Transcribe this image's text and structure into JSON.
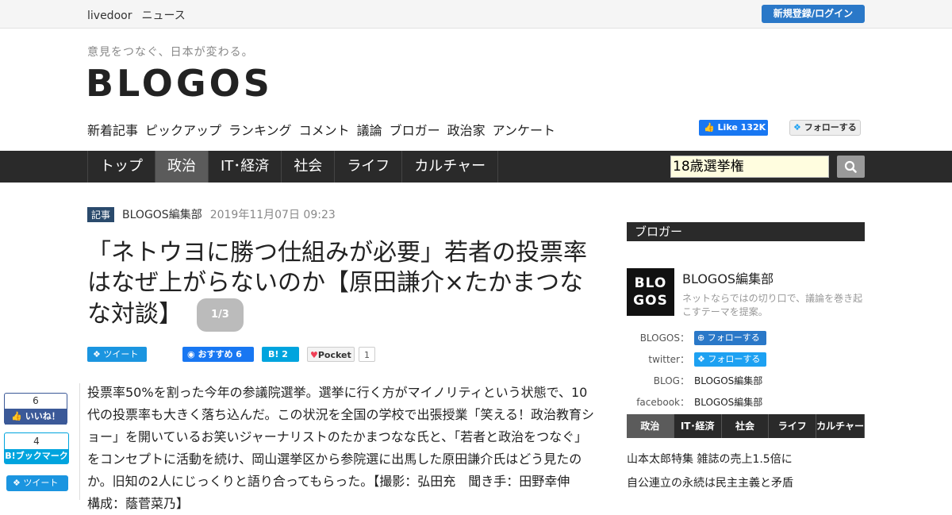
{
  "topbar": {
    "brand1": "livedoor",
    "brand2": "ニュース",
    "login": "新規登録/ログイン"
  },
  "header": {
    "tagline": "意見をつなぐ、日本が変わる。",
    "logo": "BLOGOS",
    "subnav": [
      "新着記事",
      "ピックアップ",
      "ランキング",
      "コメント",
      "議論",
      "ブロガー",
      "政治家",
      "アンケート"
    ],
    "fb_like": "Like 132K",
    "tw_follow": "フォローする"
  },
  "mainnav": {
    "items": [
      "トップ",
      "政治",
      "IT･経済",
      "社会",
      "ライフ",
      "カルチャー"
    ],
    "active": "政治",
    "search_value": "18歳選挙権"
  },
  "article": {
    "category": "記事",
    "author": "BLOGOS編集部",
    "date": "2019年11月07日 09:23",
    "title": "「ネトウヨに勝つ仕組みが必要」若者の投票率はなぜ上がらないのか【原田謙介×たかまつなな対談】",
    "page": "1/3",
    "share": {
      "tweet": "ツイート",
      "fb": "おすすめ 6",
      "hatena": "2",
      "pocket": "Pocket",
      "pocket_count": "1"
    },
    "body_lines": [
      "投票率50%を割った今年の参議院選挙。選挙に行く方がマイノリティという状態で、10",
      "代の投票率も大きく落ち込んだ。この状況を全国の学校で出張授業「笑える！政治教育シ",
      "ョー」を開いているお笑いジャーナリストのたかまつなな氏と、「若者と政治をつなぐ」",
      "をコンセプトに活動を続け、岡山選挙区から参院選に出馬した原田謙介氏はどう見たの",
      "か。旧知の2人にじっくりと語り合ってもらった。【撮影：弘田充　聞き手：田野幸伸",
      "構成：蔭菅菜乃】"
    ]
  },
  "sideshare": {
    "fb_count": "6",
    "fb_label": "いいね！",
    "hb_count": "4",
    "hb_label": "B!ブックマーク",
    "tw_label": "ツイート"
  },
  "sidebar": {
    "heading": "ブロガー",
    "avatar_l1": "BLO",
    "avatar_l2": "GOS",
    "name": "BLOGOS編集部",
    "desc": "ネットならではの切り口で、議論を巻き起こすテーマを提案。",
    "rows": [
      {
        "label": "BLOGOS：",
        "value": "フォローする"
      },
      {
        "label": "twitter：",
        "value": "フォローする"
      },
      {
        "label": "BLOG：",
        "value": "BLOGOS編集部"
      },
      {
        "label": "facebook：",
        "value": "BLOGOS編集部"
      }
    ],
    "tabs": [
      "政治",
      "IT･経済",
      "社会",
      "ライフ",
      "カルチャー"
    ],
    "news": [
      "山本太郎特集 雑誌の売上1.5倍に",
      "自公連立の永続は民主主義と矛盾"
    ]
  }
}
